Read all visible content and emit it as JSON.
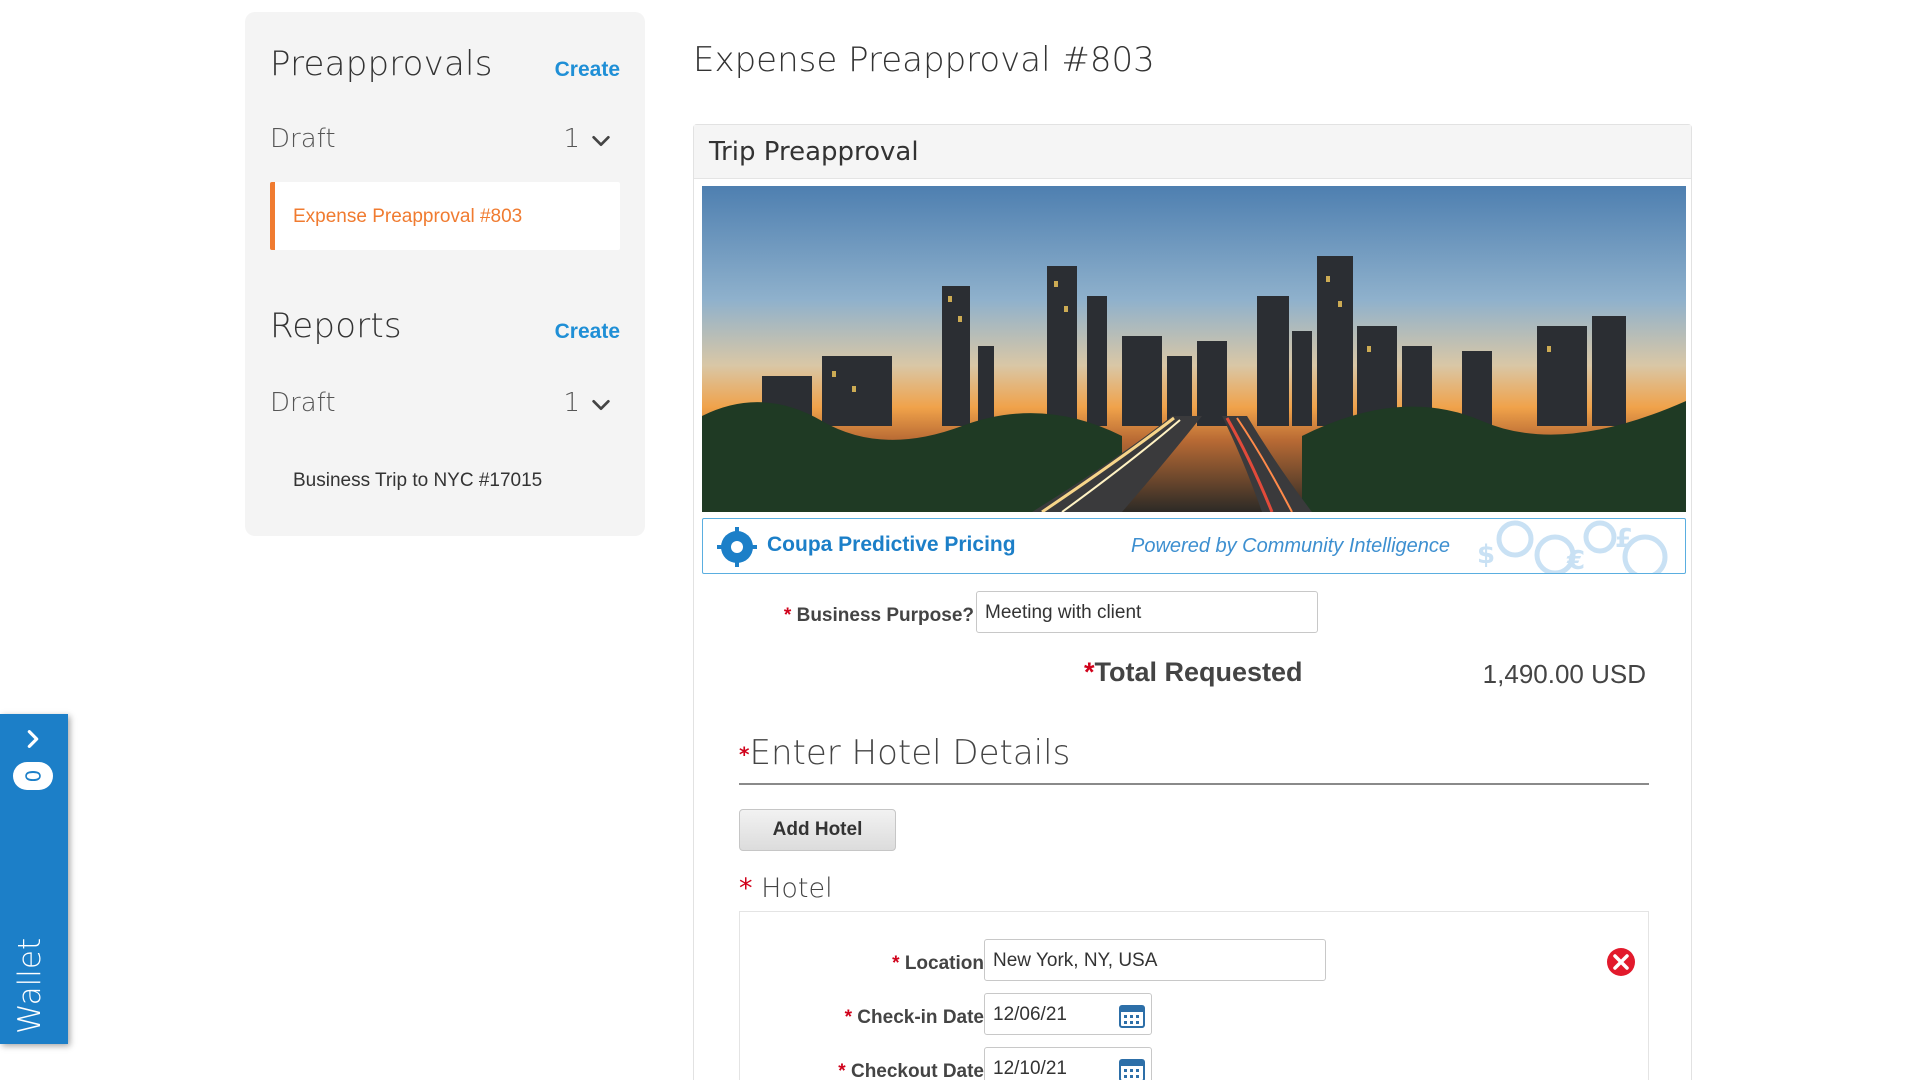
{
  "sidebar": {
    "preapprovals": {
      "title": "Preapprovals",
      "create_label": "Create",
      "draft_label": "Draft",
      "draft_count": "1",
      "items": [
        {
          "label": "Expense Preapproval #803",
          "active": true
        }
      ]
    },
    "reports": {
      "title": "Reports",
      "create_label": "Create",
      "draft_label": "Draft",
      "draft_count": "1",
      "items": [
        {
          "label": "Business Trip to NYC #17015",
          "active": false
        }
      ]
    }
  },
  "wallet": {
    "label": "Wallet",
    "count": "0"
  },
  "main": {
    "page_title": "Expense Preapproval #803",
    "card_title": "Trip Preapproval",
    "hero_image": "city-skyline-dusk",
    "pricing_banner": {
      "title": "Coupa Predictive Pricing",
      "subtitle": "Powered by Community Intelligence"
    },
    "business_purpose": {
      "label": "Business Purpose?",
      "value": "Meeting with client"
    },
    "total": {
      "label": "Total Requested",
      "value": "1,490.00 USD"
    },
    "hotel_section": {
      "title": "Enter Hotel Details",
      "add_button": "Add Hotel",
      "hotel_heading": "Hotel",
      "location": {
        "label": "Location",
        "value": "New York, NY, USA"
      },
      "checkin": {
        "label": "Check-in Date",
        "value": "12/06/21"
      },
      "checkout": {
        "label": "Checkout Date",
        "value": "12/10/21"
      }
    }
  },
  "colors": {
    "accent": "#f07b30",
    "link": "#1f8fd6",
    "wallet": "#1c7fc8",
    "required": "#d0021b"
  }
}
